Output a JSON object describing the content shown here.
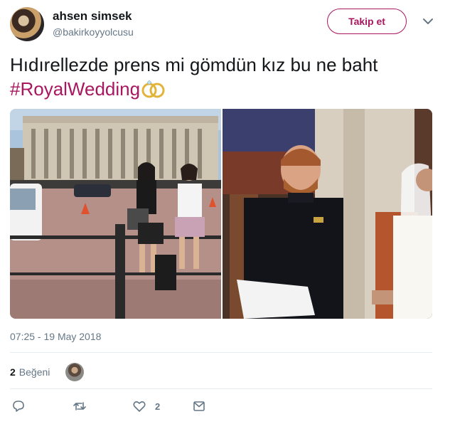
{
  "user": {
    "name": "ahsen simsek",
    "handle": "@bakirkoyyolcusu",
    "follow_label": "Takip et"
  },
  "tweet": {
    "text": "Hıdırellezde prens mi gömdün kız bu ne baht",
    "hashtag": "#RoyalWedding",
    "timestamp": "07:25 - 19 May 2018"
  },
  "stats": {
    "likes_count": "2",
    "likes_label": "Beğeni"
  },
  "actions": {
    "like_count": "2"
  },
  "colors": {
    "accent": "#a8175f",
    "muted": "#657786",
    "divider": "#e6ecf0"
  },
  "icons": {
    "reply": "reply-icon",
    "retweet": "retweet-icon",
    "like": "heart-icon",
    "message": "message-icon",
    "caret": "chevron-down-icon",
    "rings": "rings-emoji-icon"
  }
}
